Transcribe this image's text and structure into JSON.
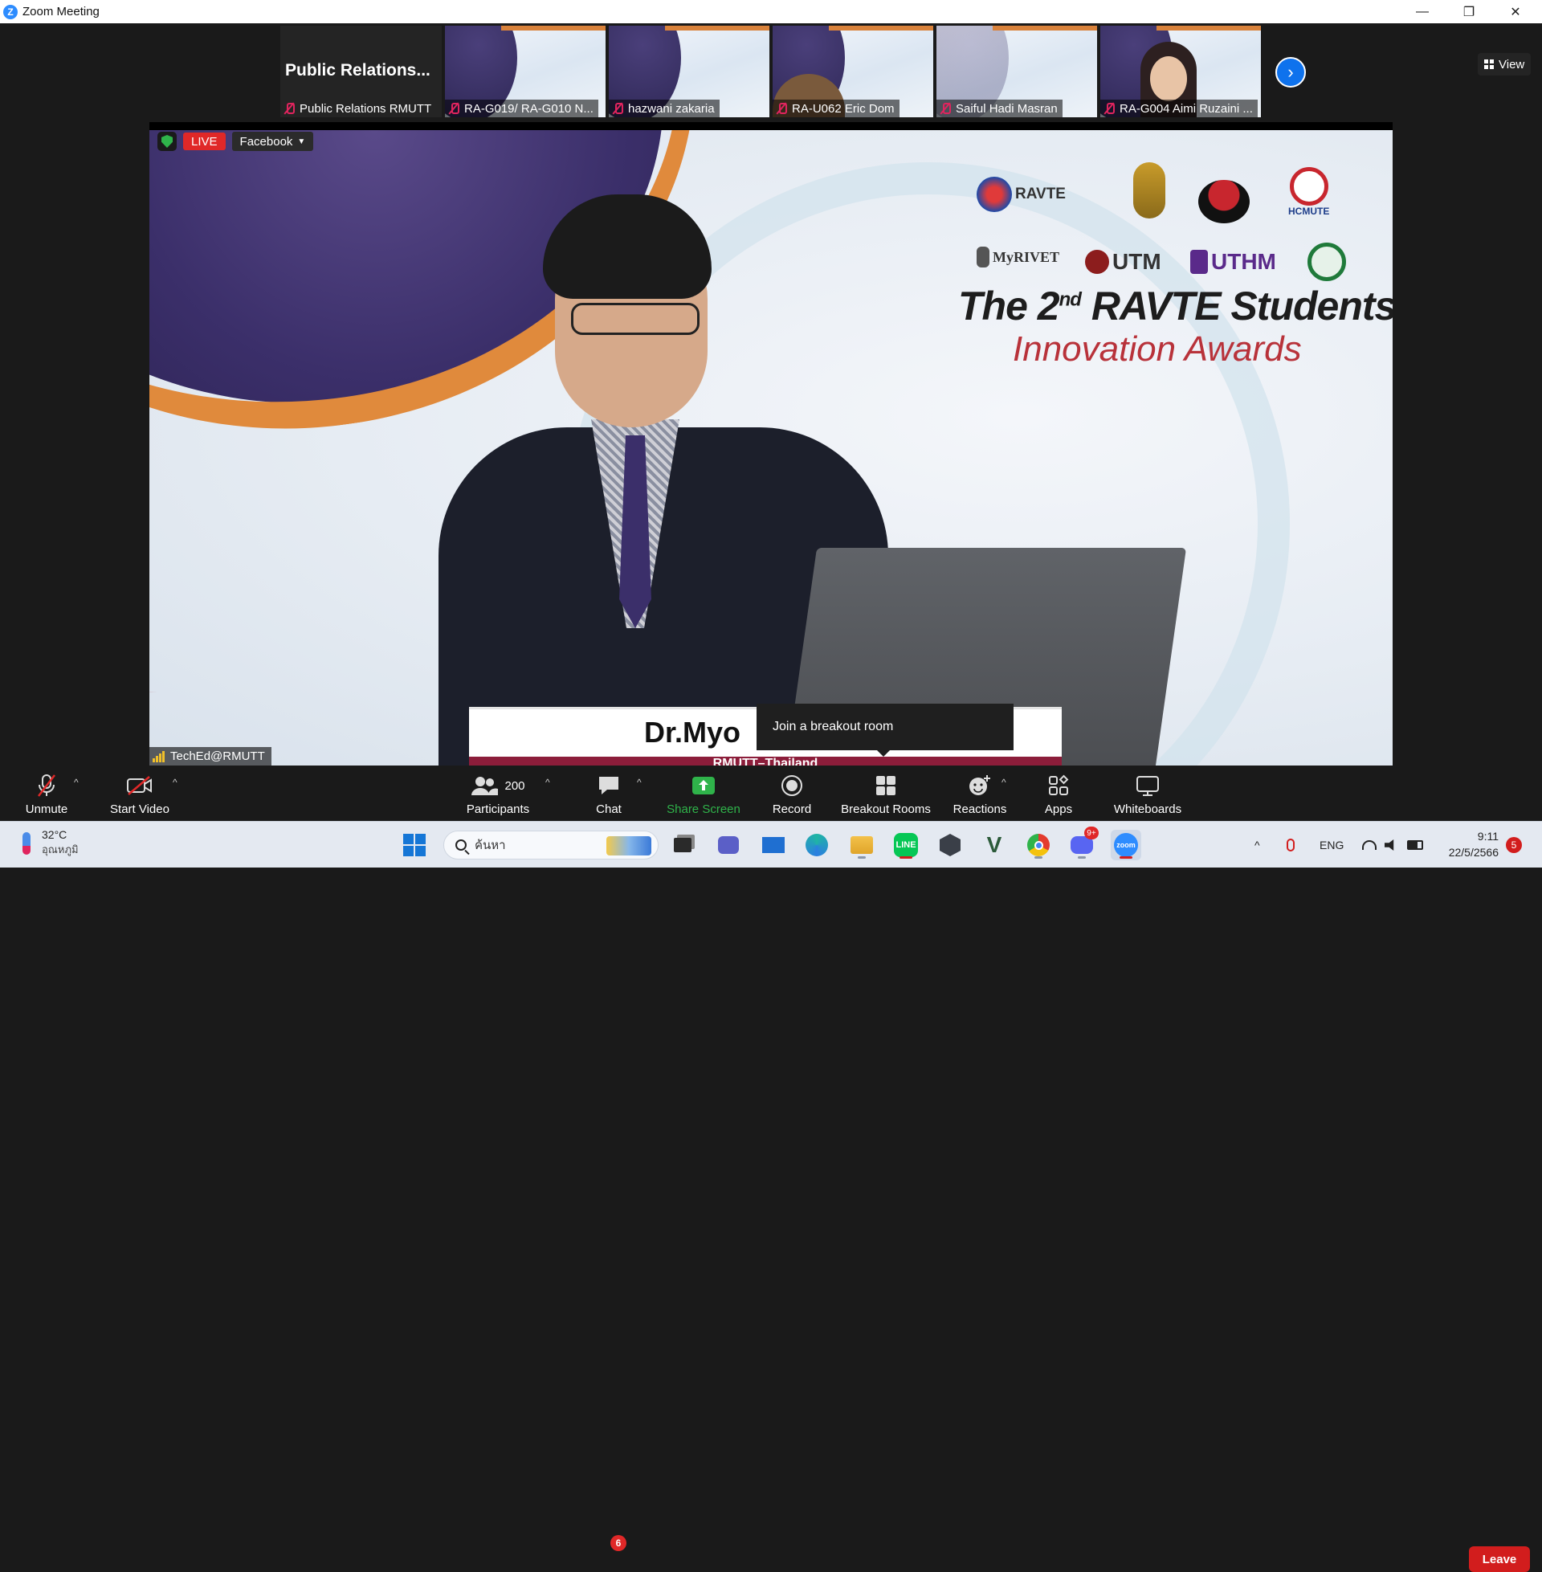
{
  "window": {
    "title": "Zoom Meeting",
    "controls": {
      "minimize": "—",
      "restore": "❐",
      "close": "✕"
    }
  },
  "gallery": {
    "pinned_title": "Public  Relations...",
    "participants": [
      {
        "name": "Public Relations RMUTT",
        "muted": true
      },
      {
        "name": "RA-G019/ RA-G010 N...",
        "muted": true
      },
      {
        "name": "hazwani zakaria",
        "muted": true
      },
      {
        "name": "RA-U062 Eric Dom",
        "muted": true
      },
      {
        "name": "Saiful Hadi Masran",
        "muted": true
      },
      {
        "name": "RA-G004 Aimi Ruzaini ...",
        "muted": true
      }
    ],
    "next_icon": "chevron-right-icon",
    "view_label": "View"
  },
  "stage": {
    "live_label": "LIVE",
    "platform": "Facebook",
    "logos": [
      "RAVTE",
      "MyRIVET",
      "UTM",
      "UTHM",
      "HCMUTE"
    ],
    "event_title": "The 2",
    "event_title_sup": "nd",
    "event_title_rest": " RAVTE Students",
    "event_subtitle": "Innovation Awards",
    "speaker_name": "Dr.Myo",
    "speaker_org": "RMUTT–Thailand",
    "active_speaker_label": "TechEd@RMUTT",
    "tooltip": "Join a breakout room"
  },
  "toolbar": {
    "unmute": "Unmute",
    "start_video": "Start Video",
    "participants_count": "200",
    "participants": "Participants",
    "chat": "Chat",
    "chat_badge": "6",
    "share_screen": "Share Screen",
    "record": "Record",
    "breakout_rooms": "Breakout Rooms",
    "reactions": "Reactions",
    "apps": "Apps",
    "whiteboards": "Whiteboards",
    "leave": "Leave"
  },
  "taskbar": {
    "temperature": "32°C",
    "weather_label": "อุณหภูมิ",
    "search_placeholder": "ค้นหา",
    "language": "ENG",
    "time": "9:11",
    "date": "22/5/2566",
    "notification_count": "5",
    "discord_badge": "9+"
  },
  "colors": {
    "zoom_blue": "#0e72ed",
    "share_green": "#2fb34a",
    "leave_red": "#d21d1d",
    "live_red": "#e02828"
  }
}
